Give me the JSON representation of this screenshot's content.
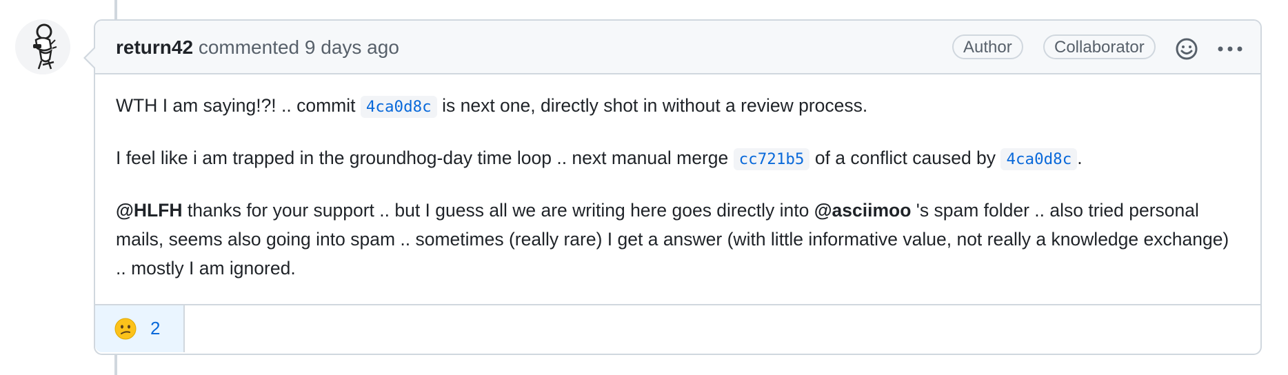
{
  "comment": {
    "author": "return42",
    "action": "commented",
    "time": "9 days ago",
    "labels": {
      "author": "Author",
      "collaborator": "Collaborator"
    },
    "icons": {
      "avatar": "octocat-avatar",
      "reaction_add": "smiley-icon",
      "more": "kebab-horizontal-icon"
    },
    "body": {
      "p1": {
        "pre": "WTH I am saying!?! .. commit",
        "sha": "4ca0d8c",
        "post": "is next one, directly shot in without a review process."
      },
      "p2": {
        "pre": "I feel like i am trapped in the groundhog-day time loop .. next manual merge",
        "sha1": "cc721b5",
        "mid": "of a conflict caused by",
        "sha2": "4ca0d8c",
        "post": "."
      },
      "p3": {
        "mention1": "@HLFH",
        "text1": "thanks for your support .. but I guess all we are writing here goes directly into",
        "mention2": "@asciimoo",
        "text2": "'s spam folder .. also tried personal mails, seems also going into spam .. sometimes (really rare) I get a answer (with little informative value, not really a knowledge exchange) .. mostly I am ignored."
      }
    },
    "reactions": [
      {
        "emoji": "confused-face",
        "count": "2"
      }
    ]
  },
  "colors": {
    "link": "#0969da",
    "border": "#d0d7de",
    "header_bg": "#f6f8fa",
    "muted": "#57606a",
    "reaction_bg": "#eaf5ff"
  }
}
